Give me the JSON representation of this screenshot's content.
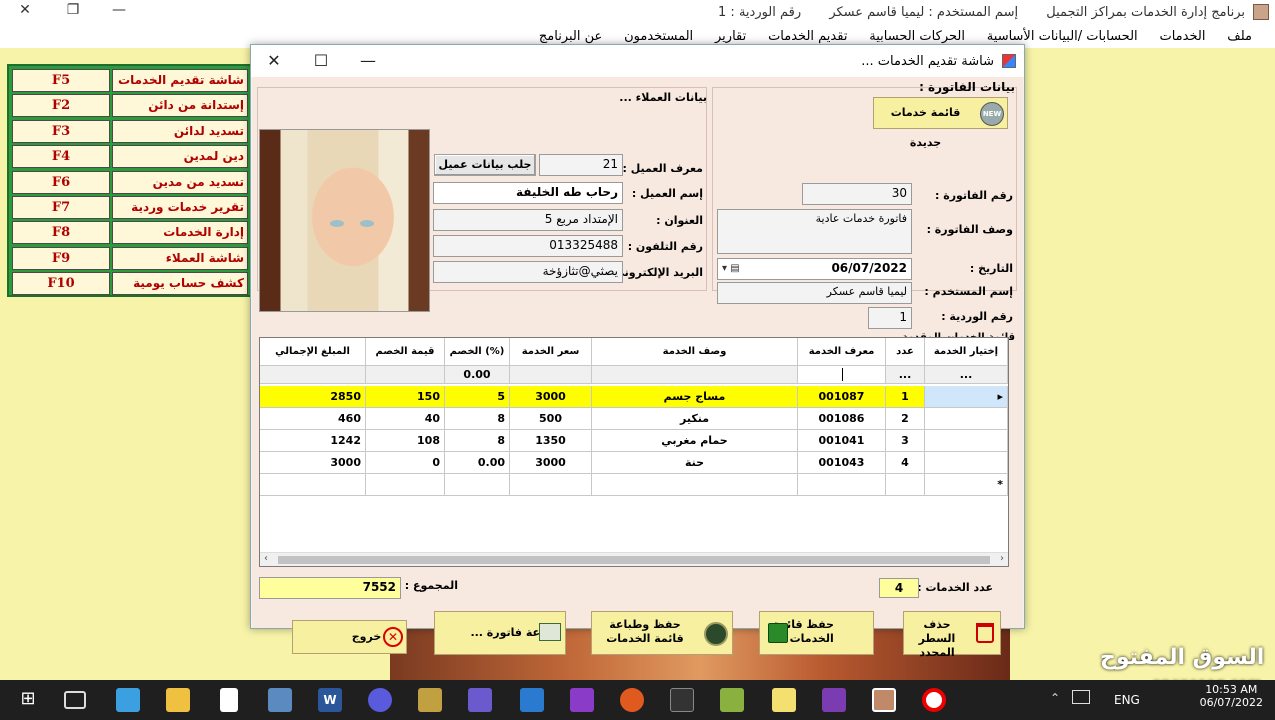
{
  "app": {
    "title": "برنامج إدارة الخدمات بمراكز التجميل",
    "user_info": "إسم المستخدم : ليميا قاسم عسكر",
    "shift_info": "رقم الوردية : 1"
  },
  "menu": [
    "ملف",
    "الخدمات",
    "الحسابات /البيانات الأساسية",
    "الحركات الحسابية",
    "تقديم الخدمات",
    "تقارير",
    "المستخدمون",
    "عن البرنامج"
  ],
  "shortcuts": [
    {
      "label": "شاشة تقديم الخدمات",
      "key": "F5"
    },
    {
      "label": "إستدانة من دائن",
      "key": "F2"
    },
    {
      "label": "تسديد لدائن",
      "key": "F3"
    },
    {
      "label": "دين لمدين",
      "key": "F4"
    },
    {
      "label": "تسديد من مدين",
      "key": "F6"
    },
    {
      "label": "تقرير خدمات وردية",
      "key": "F7"
    },
    {
      "label": "إدارة الخدمات",
      "key": "F8"
    },
    {
      "label": "شاشة العملاء",
      "key": "F9"
    },
    {
      "label": "كشف حساب يومية",
      "key": "F10"
    }
  ],
  "dialog": {
    "title": "شاشة تقديم الخدمات ...",
    "customer": {
      "section_title": "بيانات العملاء ...",
      "id_label": "معرف العميل :",
      "id_value": "21",
      "fetch_button": "جلب بيانات عميل",
      "name_label": "إسم العميل :",
      "name_value": "رحاب طه الخليفة",
      "address_label": "العنوان :",
      "address_value": "الإمتداد مربع 5",
      "phone_label": "رقم التلفون :",
      "phone_value": "013325488",
      "email_label": "البريد الإلكتروني :",
      "email_value": "يصثي@تثازؤخة"
    },
    "invoice": {
      "section_title": "بيانات الفاتورة :",
      "new_list_button": "قائمة خدمات جديدة",
      "new_badge": "NEW",
      "number_label": "رقم الفاتورة :",
      "number_value": "30",
      "desc_label": "وصف الفاتورة :",
      "desc_value": "فاتورة خدمات عادية",
      "date_label": "التاريخ :",
      "date_value": "06/07/2022",
      "user_label": "إسم المستخدم :",
      "user_value": "ليميا قاسم عسكر",
      "shift_label": "رقم الوردية :",
      "shift_value": "1"
    },
    "grid": {
      "section_title": "قائمة الخدمات المقدمة ...",
      "headers": [
        "إختيار الخدمة",
        "عدد",
        "معرف الخدمة",
        "وصف الخدمة",
        "سعر الخدمة",
        "الخصم (%)",
        "قيمة الخصم",
        "المبلغ الإجمالي"
      ],
      "filter_row": {
        "pick": "...",
        "count": "...",
        "discount": "0.00"
      },
      "rows": [
        {
          "n": "1",
          "id": "001087",
          "desc": "مساج جسم",
          "price": "3000",
          "disc_pct": "5",
          "disc_val": "150",
          "total": "2850"
        },
        {
          "n": "2",
          "id": "001086",
          "desc": "منكير",
          "price": "500",
          "disc_pct": "8",
          "disc_val": "40",
          "total": "460"
        },
        {
          "n": "3",
          "id": "001041",
          "desc": "حمام مغربي",
          "price": "1350",
          "disc_pct": "8",
          "disc_val": "108",
          "total": "1242"
        },
        {
          "n": "4",
          "id": "001043",
          "desc": "حنة",
          "price": "3000",
          "disc_pct": "0.00",
          "disc_val": "0",
          "total": "3000"
        }
      ],
      "new_row_marker": "*",
      "current_row_marker": "▸"
    },
    "count_label": "عدد الخدمات :",
    "count_value": "4",
    "total_label": "المجموع :",
    "total_value": "7552",
    "buttons": {
      "delete": "حذف السطر المحدد",
      "save": "حفظ قائمة الخدمات ...",
      "save_print": "حفظ وطباعة قائمة الخدمات",
      "print": "طباعة فاتورة ...",
      "exit": "خروج"
    }
  },
  "taskbar": {
    "lang": "ENG",
    "time": "10:53 AM",
    "date": "06/07/2022"
  },
  "watermark": {
    "arabic": "السوق المفتوح",
    "latin": "opensooq.com"
  },
  "colors": {
    "desktop": "#f7f3a8",
    "panel_green": "#2e9a3e",
    "selected_row": "#fefe00",
    "shortcut_text": "#b00000"
  }
}
